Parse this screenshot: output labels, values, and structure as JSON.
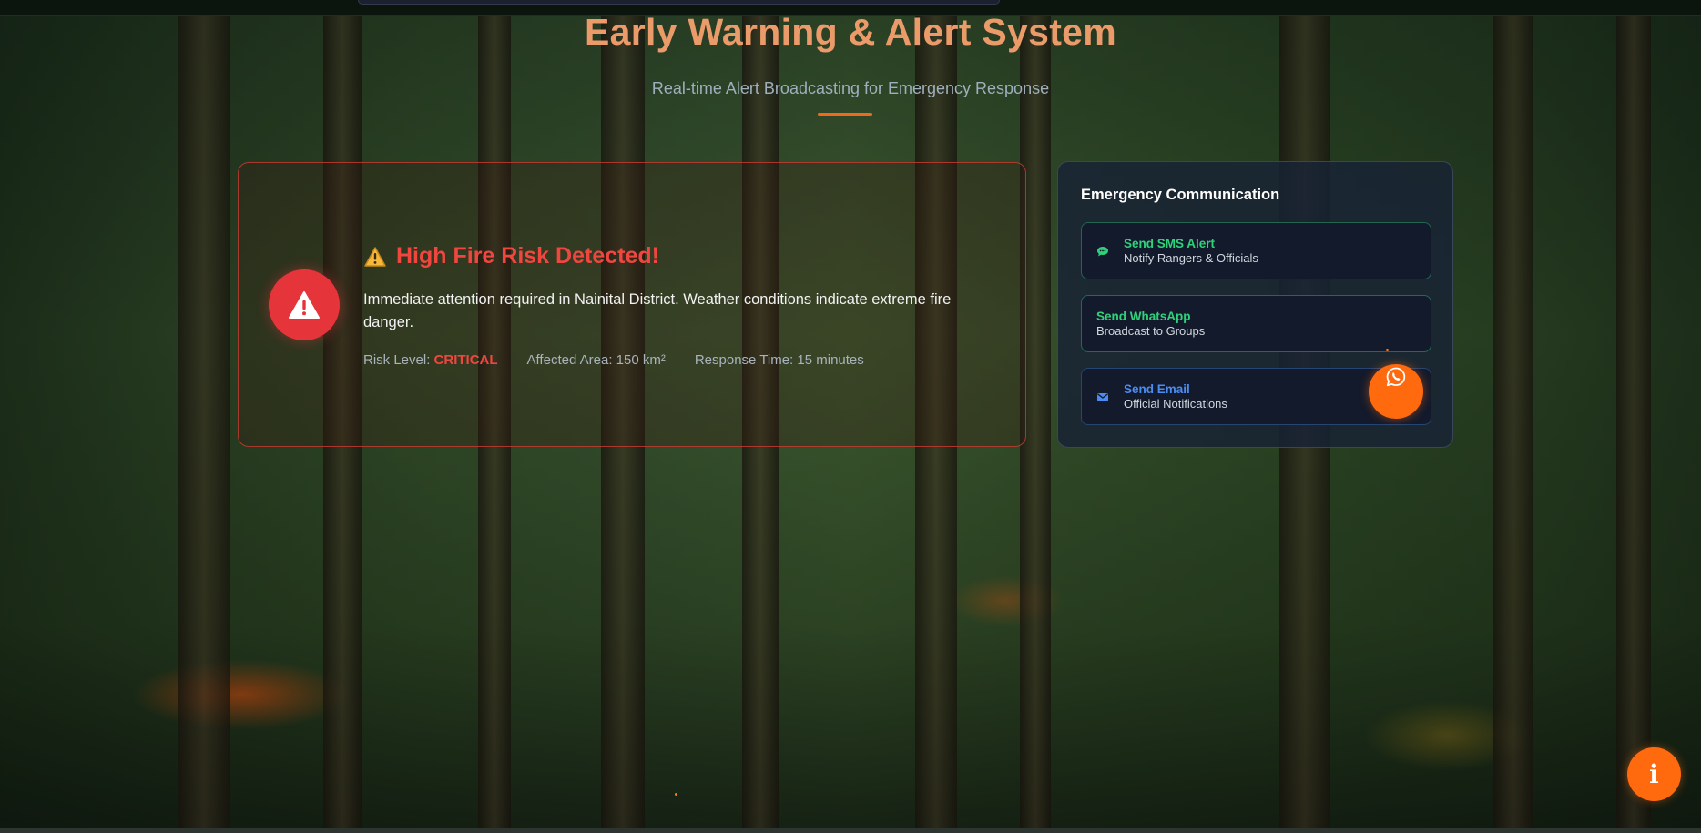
{
  "header": {
    "title": "Early Warning & Alert System",
    "subtitle": "Real-time Alert Broadcasting for Emergency Response"
  },
  "alert": {
    "icon": "warning-triangle-icon",
    "emoji": "⚠️",
    "title": "High Fire Risk Detected!",
    "message": "Immediate attention required in Nainital District. Weather conditions indicate extreme fire danger.",
    "risk_label": "Risk Level: ",
    "risk_value": "CRITICAL",
    "affected_area": "Affected Area: 150 km²",
    "response_time": "Response Time: 15 minutes"
  },
  "communication": {
    "title": "Emergency Communication",
    "buttons": [
      {
        "label": "Send SMS Alert",
        "sub": "Notify Rangers & Officials",
        "icon": "chat-icon"
      },
      {
        "label": "Send WhatsApp",
        "sub": "Broadcast to Groups",
        "icon": "whatsapp-icon"
      },
      {
        "label": "Send Email",
        "sub": "Official Notifications",
        "icon": "envelope-icon"
      }
    ]
  },
  "floating": {
    "whatsapp_icon": "whatsapp-icon",
    "info_label": "i"
  },
  "colors": {
    "accent": "#ff6a0f",
    "danger": "#e5353b",
    "sms_green": "#2fd27b",
    "email_blue": "#4a8cf2"
  }
}
